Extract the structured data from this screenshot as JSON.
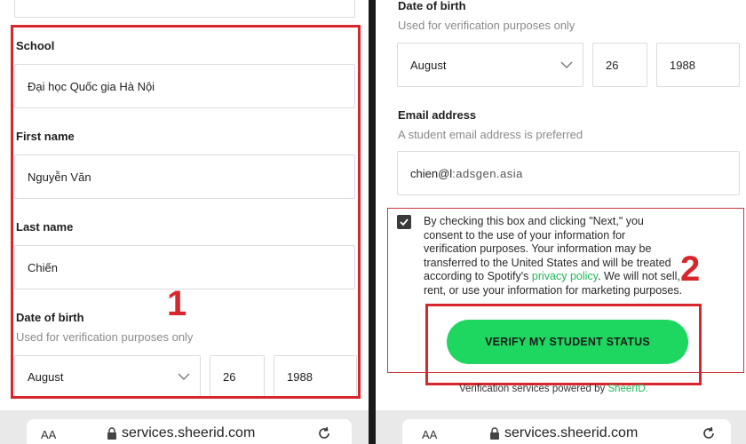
{
  "left": {
    "school": {
      "label": "School",
      "value": "Đại học Quốc gia Hà Nội"
    },
    "first_name": {
      "label": "First name",
      "value": "Nguyễn Văn"
    },
    "last_name": {
      "label": "Last name",
      "value": "Chiến"
    },
    "dob": {
      "label": "Date of birth",
      "hint": "Used for verification purposes only",
      "month": "August",
      "day": "26",
      "year": "1988"
    },
    "step_number": "1"
  },
  "right": {
    "dob": {
      "label": "Date of birth",
      "hint": "Used for verification purposes only",
      "month": "August",
      "day": "26",
      "year": "1988"
    },
    "email": {
      "label": "Email address",
      "hint": "A student email address is preferred",
      "value_prefix": "chien@l",
      "value_masked": ":adsgen.asia"
    },
    "consent": {
      "checked": true,
      "line1": "By checking this box and clicking \"Next,\" you",
      "line2": "consent to the use of your information for",
      "line3": "verification purposes. Your information may be",
      "line4": "transferred to the United States and will be treated",
      "line5_pre": "according to Spotify's ",
      "line5_link": "privacy policy",
      "line5_post": ". We will not sell,",
      "line6": "rent, or use your information for marketing purposes."
    },
    "verify_button": "VERIFY MY STUDENT STATUS",
    "powered_pre": "Verification services powered by ",
    "powered_brand": "SheerID.",
    "step_number": "2"
  },
  "browser": {
    "text_size": "AA",
    "url": "services.sheerid.com"
  },
  "colors": {
    "accent_red": "#d8262d",
    "spotify_green": "#1ed760",
    "link_green": "#1db954"
  }
}
